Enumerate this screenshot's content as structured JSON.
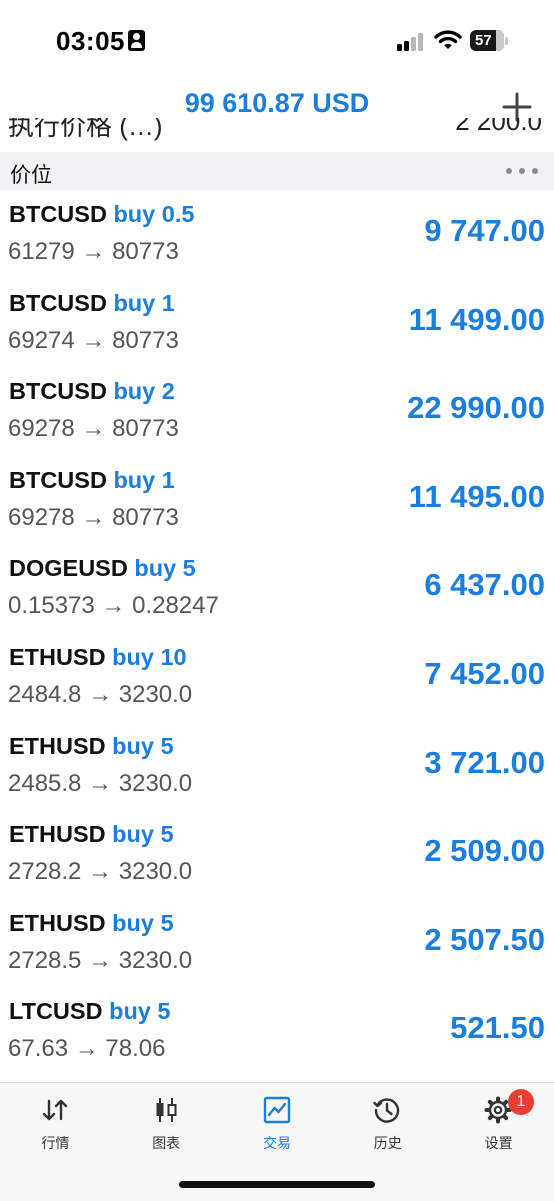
{
  "status_bar": {
    "time": "03:05",
    "battery": "57"
  },
  "header": {
    "title": "99 610.87 USD",
    "add_icon": "plus-icon"
  },
  "cutoff_row": {
    "left_text": "执行价格 (…)",
    "right_text": "2 200.0"
  },
  "section": {
    "label": "价位",
    "more_icon": "more-dots-icon"
  },
  "positions": [
    {
      "symbol": "BTCUSD",
      "side": "buy 0.5",
      "prices": "61279 → 80773",
      "profit": "9 747.00"
    },
    {
      "symbol": "BTCUSD",
      "side": "buy 1",
      "prices": "69274 → 80773",
      "profit": "11 499.00"
    },
    {
      "symbol": "BTCUSD",
      "side": "buy 2",
      "prices": "69278 → 80773",
      "profit": "22 990.00"
    },
    {
      "symbol": "BTCUSD",
      "side": "buy 1",
      "prices": "69278 → 80773",
      "profit": "11 495.00"
    },
    {
      "symbol": "DOGEUSD",
      "side": "buy 5",
      "prices": "0.15373 → 0.28247",
      "profit": "6 437.00"
    },
    {
      "symbol": "ETHUSD",
      "side": "buy 10",
      "prices": "2484.8 → 3230.0",
      "profit": "7 452.00"
    },
    {
      "symbol": "ETHUSD",
      "side": "buy 5",
      "prices": "2485.8 → 3230.0",
      "profit": "3 721.00"
    },
    {
      "symbol": "ETHUSD",
      "side": "buy 5",
      "prices": "2728.2 → 3230.0",
      "profit": "2 509.00"
    },
    {
      "symbol": "ETHUSD",
      "side": "buy 5",
      "prices": "2728.5 → 3230.0",
      "profit": "2 507.50"
    },
    {
      "symbol": "LTCUSD",
      "side": "buy 5",
      "prices": "67.63 → 78.06",
      "profit": "521.50"
    }
  ],
  "tabs": [
    {
      "label": "行情",
      "icon": "quotes-arrows-icon"
    },
    {
      "label": "图表",
      "icon": "candlestick-chart-icon"
    },
    {
      "label": "交易",
      "icon": "trade-chart-icon",
      "active": true
    },
    {
      "label": "历史",
      "icon": "history-clock-icon"
    },
    {
      "label": "设置",
      "icon": "settings-gear-icon"
    }
  ],
  "settings_badge": "1",
  "colors": {
    "accent": "#1a7de0",
    "badge": "#ea3c32",
    "section_bg": "#f2f2f4"
  }
}
